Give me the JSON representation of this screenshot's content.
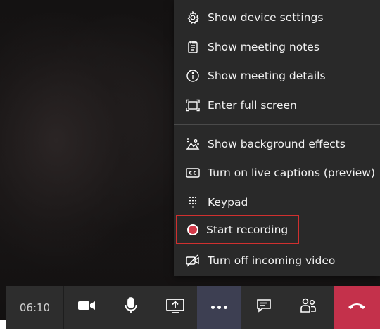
{
  "menu": {
    "items": [
      {
        "label": "Show device settings",
        "icon": "gear-icon"
      },
      {
        "label": "Show meeting notes",
        "icon": "notes-icon"
      },
      {
        "label": "Show meeting details",
        "icon": "info-icon"
      },
      {
        "label": "Enter full screen",
        "icon": "fullscreen-icon"
      },
      {
        "label": "Show background effects",
        "icon": "background-effects-icon"
      },
      {
        "label": "Turn on live captions (preview)",
        "icon": "captions-icon"
      },
      {
        "label": "Keypad",
        "icon": "keypad-icon"
      },
      {
        "label": "Start recording",
        "icon": "record-icon",
        "highlighted": true
      },
      {
        "label": "Turn off incoming video",
        "icon": "video-off-icon"
      }
    ]
  },
  "toolbar": {
    "timer": "06:10",
    "buttons": [
      {
        "name": "camera",
        "icon": "camera-icon"
      },
      {
        "name": "microphone",
        "icon": "microphone-icon"
      },
      {
        "name": "share-screen",
        "icon": "share-screen-icon"
      },
      {
        "name": "more-actions",
        "icon": "more-icon",
        "active": true
      },
      {
        "name": "chat",
        "icon": "chat-icon"
      },
      {
        "name": "participants",
        "icon": "participants-icon"
      },
      {
        "name": "hang-up",
        "icon": "hang-up-icon"
      }
    ]
  },
  "colors": {
    "menu_bg": "#292929",
    "toolbar_bg": "#2d2d2d",
    "active_button": "#3d3f52",
    "hangup_red": "#c4314b",
    "highlight_border": "#d0302f",
    "record_dot": "#d33a4a"
  }
}
